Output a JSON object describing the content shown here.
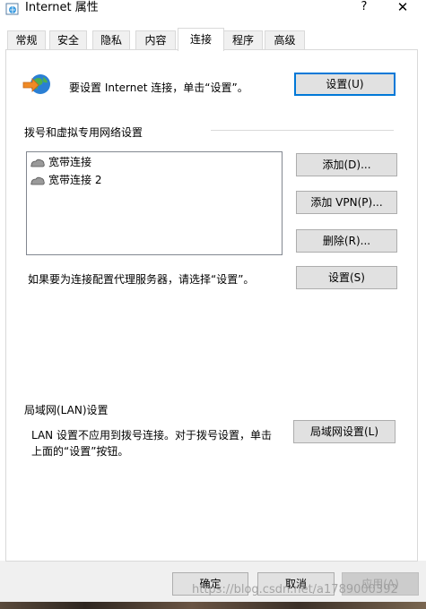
{
  "window": {
    "title": "Internet 属性",
    "help_glyph": "?",
    "close_glyph": "✕"
  },
  "tabs": [
    {
      "label": "常规"
    },
    {
      "label": "安全"
    },
    {
      "label": "隐私"
    },
    {
      "label": "内容"
    },
    {
      "label": "连接",
      "active": true
    },
    {
      "label": "程序"
    },
    {
      "label": "高级"
    }
  ],
  "connection": {
    "setup_text": "要设置 Internet 连接，单击“设置”。",
    "setup_button": "设置(U)"
  },
  "dialup": {
    "section_title": "拨号和虚拟专用网络设置",
    "items": [
      {
        "label": "宽带连接"
      },
      {
        "label": "宽带连接 2"
      }
    ],
    "add_button": "添加(D)...",
    "add_vpn_button": "添加 VPN(P)...",
    "delete_button": "删除(R)...",
    "proxy_text": "如果要为连接配置代理服务器，请选择“设置”。",
    "settings_button": "设置(S)"
  },
  "lan": {
    "section_title": "局域网(LAN)设置",
    "text_line1": "LAN 设置不应用到拨号连接。对于拨号设置，单击",
    "text_line2": "上面的“设置”按钮。",
    "button": "局域网设置(L)"
  },
  "footer": {
    "ok": "确定",
    "cancel": "取消",
    "apply": "应用(A)",
    "watermark": "https://blog.csdn.net/a1789000392"
  },
  "colors": {
    "focus_border": "#0078d7",
    "button_bg": "#e1e1e1",
    "dialog_bg": "#f0f0f0"
  }
}
